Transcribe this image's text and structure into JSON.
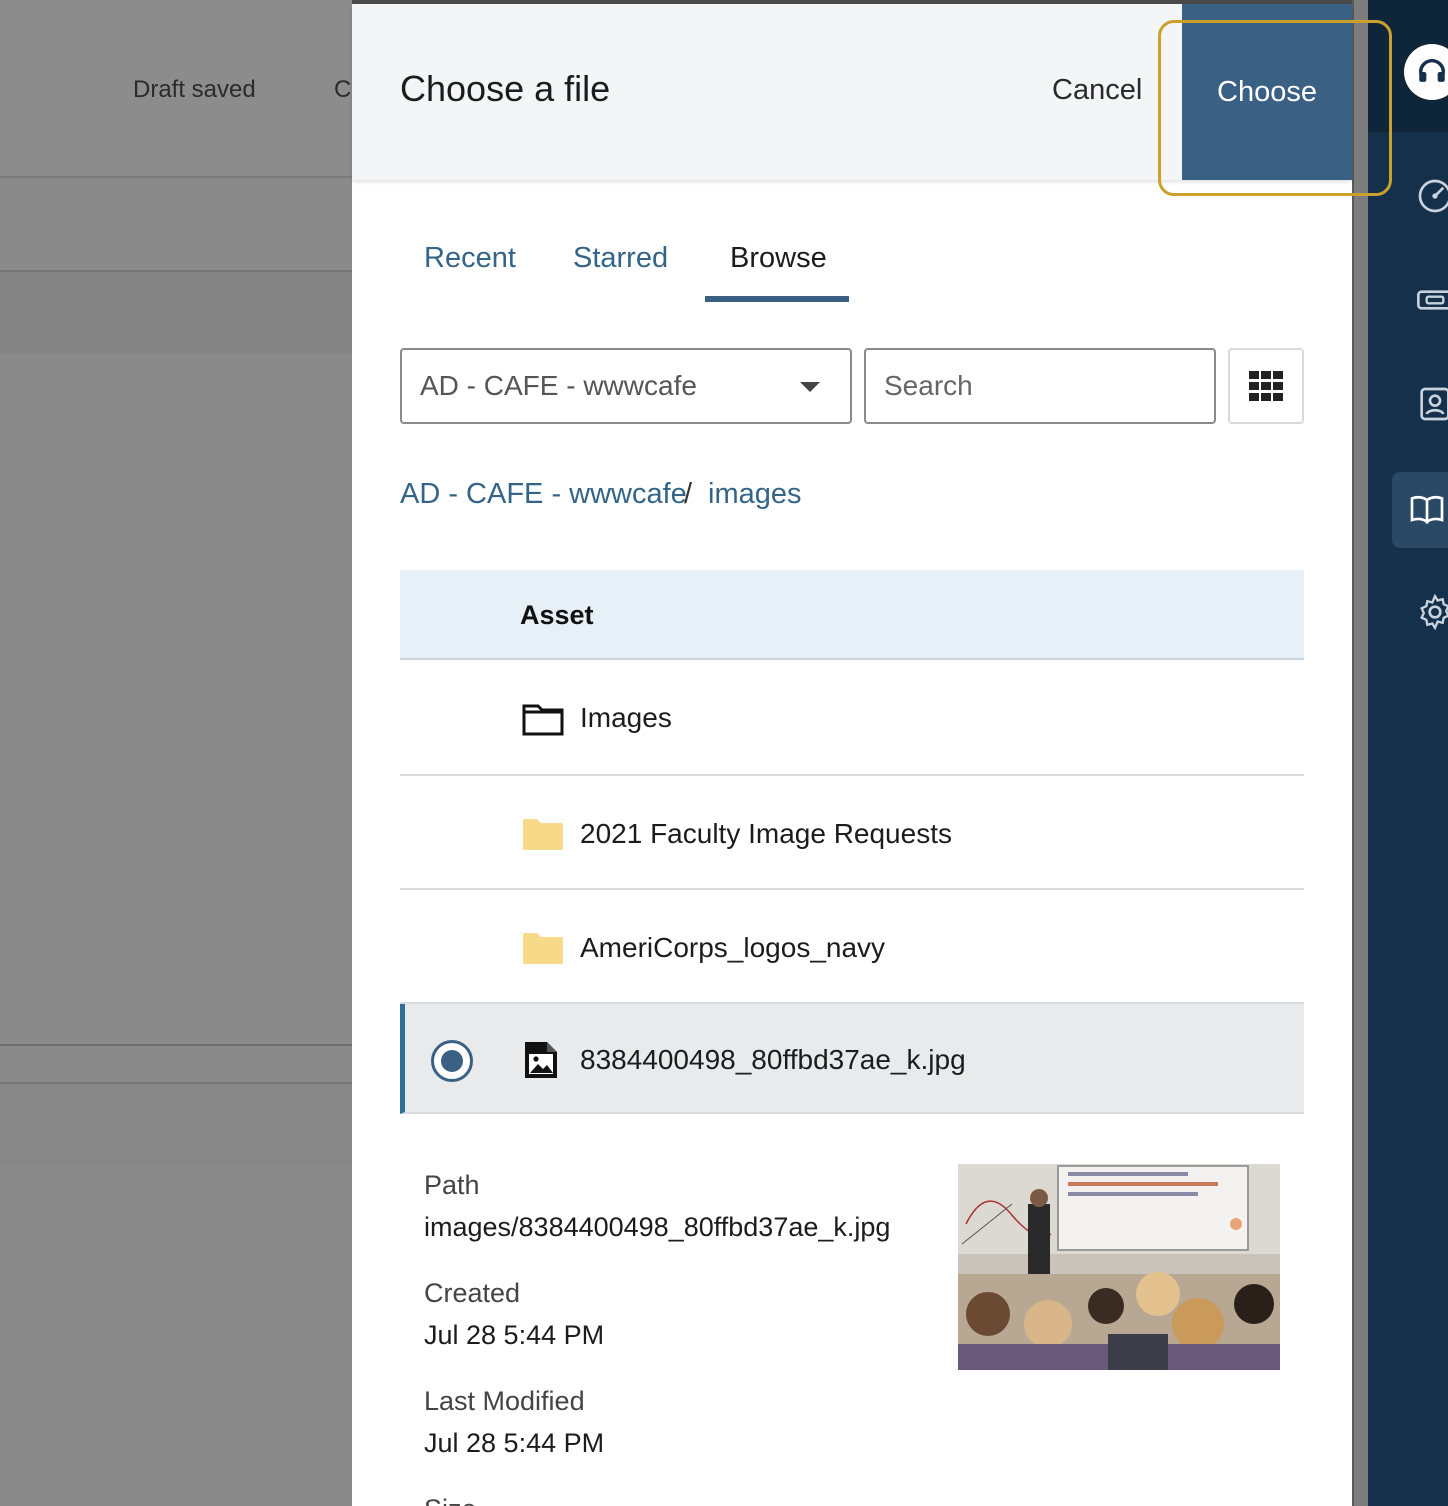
{
  "background": {
    "status": "Draft saved",
    "partial_button": "C"
  },
  "modal": {
    "title": "Choose a file",
    "cancel_label": "Cancel",
    "choose_label": "Choose",
    "tabs": [
      {
        "label": "Recent",
        "active": false
      },
      {
        "label": "Starred",
        "active": false
      },
      {
        "label": "Browse",
        "active": true
      }
    ],
    "site_select": {
      "value": "AD - CAFE - wwwcafe"
    },
    "search": {
      "placeholder": "Search",
      "value": ""
    },
    "view_toggle_icon": "grid-view-icon",
    "breadcrumb": {
      "items": [
        "AD - CAFE - wwwcafe",
        "images"
      ],
      "separator": "/"
    },
    "table": {
      "column_header": "Asset",
      "rows": [
        {
          "label": "Images",
          "icon": "folder-outline-icon",
          "selected": false
        },
        {
          "label": "2021 Faculty Image Requests",
          "icon": "folder-icon",
          "selected": false
        },
        {
          "label": "AmeriCorps_logos_navy",
          "icon": "folder-icon",
          "selected": false
        },
        {
          "label": "8384400498_80ffbd37ae_k.jpg",
          "icon": "image-file-icon",
          "selected": true
        }
      ]
    },
    "details": {
      "path_label": "Path",
      "path_value": "images/8384400498_80ffbd37ae_k.jpg",
      "created_label": "Created",
      "created_value": "Jul 28 5:44 PM",
      "modified_label": "Last Modified",
      "modified_value": "Jul 28 5:44 PM",
      "size_label": "Size"
    }
  },
  "rail": {
    "icons": [
      "headset-icon",
      "dashboard-icon",
      "ticket-icon",
      "contact-icon",
      "book-icon",
      "gear-icon"
    ],
    "active": "book-icon"
  },
  "colors": {
    "accent": "#3a6184",
    "link": "#346588",
    "highlight": "#c9a12c",
    "rail": "#14304a",
    "folder": "#f7d98a"
  }
}
